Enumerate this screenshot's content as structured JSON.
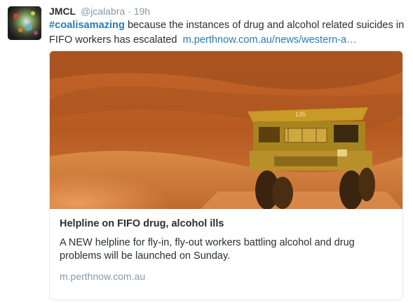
{
  "tweet": {
    "name": "JMCL",
    "handle": "@jcalabra",
    "separator": "·",
    "time": "19h",
    "hashtag": "#coalisamazing",
    "text": " because the instances of drug and alcohol related suicides in FIFO workers has escalated",
    "link": "m.perthnow.com.au/news/western-a…"
  },
  "card": {
    "image": {
      "depicts": "haul-truck",
      "truck_number": "135"
    },
    "title": "Helpline on FIFO drug, alcohol ills",
    "description": "A NEW helpline for fly-in, fly-out workers battling alcohol and drug problems will be launched on Sunday.",
    "domain": "m.perthnow.com.au"
  },
  "colors": {
    "link": "#2b7bb9",
    "muted": "#8899a6",
    "text": "#292f33",
    "border": "#e1e8ed"
  }
}
